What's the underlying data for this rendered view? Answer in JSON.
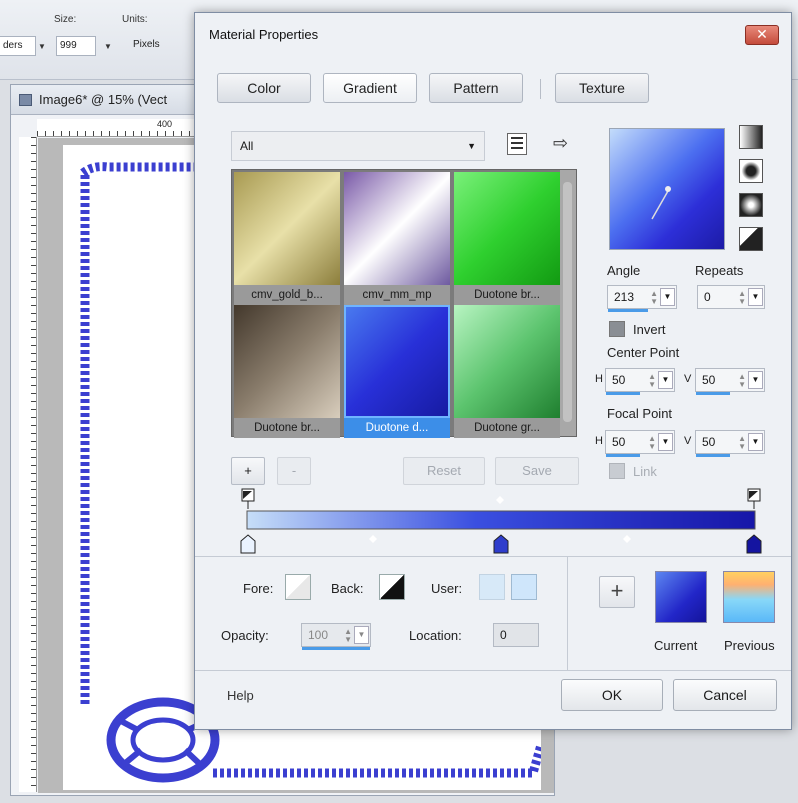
{
  "toolbar": {
    "size_label": "Size:",
    "size_value": "999",
    "units_label": "Units:",
    "units_value": "Pixels",
    "left_fragment": "ders"
  },
  "document": {
    "title": "Image6* @ 15% (Vect",
    "ruler_top_number": "400"
  },
  "dialog": {
    "title": "Material Properties",
    "close_symbol": "✕",
    "tabs": [
      {
        "label": "Color"
      },
      {
        "label": "Gradient"
      },
      {
        "label": "Pattern"
      },
      {
        "label": "Texture"
      }
    ],
    "active_tab": "Gradient",
    "category": "All",
    "gradients": [
      {
        "label": "cmv_gold_b...",
        "colors": [
          "#a89a52",
          "#e8e0a8",
          "#8c7e3c"
        ]
      },
      {
        "label": "cmv_mm_mp",
        "colors": [
          "#7a5aa8",
          "#ffffff",
          "#6e5aa0"
        ]
      },
      {
        "label": "Duotone br...",
        "colors": [
          "#7af07a",
          "#2fd02f",
          "#129a12"
        ]
      },
      {
        "label": "Duotone br...",
        "colors": [
          "#43382c",
          "#8a7d6c",
          "#d8cdbc"
        ]
      },
      {
        "label": "Duotone d...",
        "colors": [
          "#4a7cf0",
          "#2830d8",
          "#161aa0"
        ]
      },
      {
        "label": "Duotone gr...",
        "colors": [
          "#b8f4c2",
          "#5cc46e",
          "#1f7f2f"
        ]
      }
    ],
    "selected_gradient": 4,
    "buttons": {
      "add": "+",
      "remove": "-",
      "reset": "Reset",
      "save": "Save"
    },
    "angle_label": "Angle",
    "angle_value": "213",
    "repeats_label": "Repeats",
    "repeats_value": "0",
    "invert_label": "Invert",
    "center_point_label": "Center Point",
    "center_h_label": "H",
    "center_h_value": "50",
    "center_v_label": "V",
    "center_v_value": "50",
    "focal_point_label": "Focal Point",
    "focal_h_label": "H",
    "focal_h_value": "50",
    "focal_v_label": "V",
    "focal_v_value": "50",
    "link_label": "Link",
    "fore_label": "Fore:",
    "back_label": "Back:",
    "user_label": "User:",
    "opacity_label": "Opacity:",
    "opacity_value": "100",
    "location_label": "Location:",
    "location_value": "0",
    "plus_symbol": "+",
    "current_label": "Current",
    "previous_label": "Previous",
    "help_label": "Help",
    "ok_label": "OK",
    "cancel_label": "Cancel"
  },
  "colors": {
    "gradient_start": "#c6def8",
    "gradient_end": "#1616a8",
    "selection_blue": "#3c8ee8",
    "rope_blue": "#3b3fd0"
  }
}
